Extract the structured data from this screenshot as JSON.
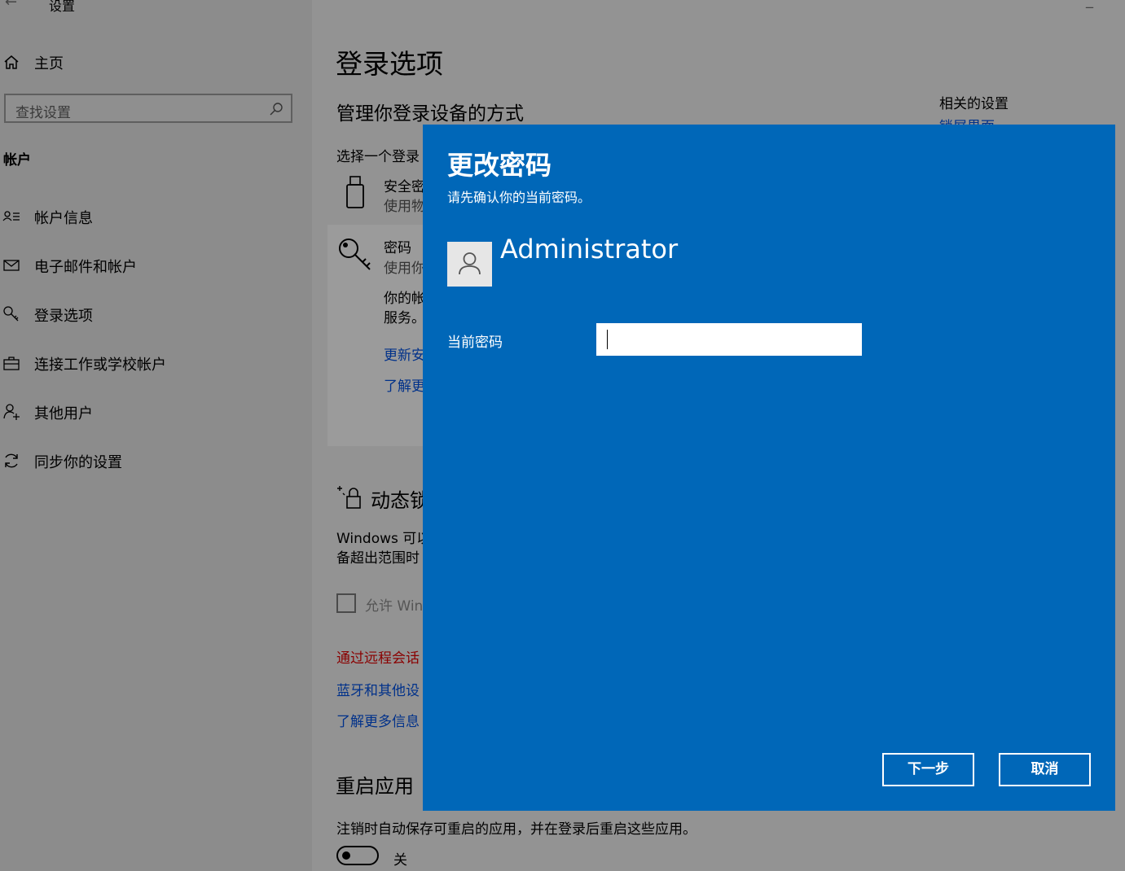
{
  "window": {
    "title": "设置"
  },
  "sidebar": {
    "home": "主页",
    "search_placeholder": "查找设置",
    "section": "帐户",
    "items": [
      {
        "label": "帐户信息",
        "icon": "account-info-icon"
      },
      {
        "label": "电子邮件和帐户",
        "icon": "mail-icon"
      },
      {
        "label": "登录选项",
        "icon": "key-icon"
      },
      {
        "label": "连接工作或学校帐户",
        "icon": "briefcase-icon"
      },
      {
        "label": "其他用户",
        "icon": "add-user-icon"
      },
      {
        "label": "同步你的设置",
        "icon": "sync-icon"
      }
    ]
  },
  "main": {
    "title": "登录选项",
    "subtitle": "管理你登录设备的方式",
    "choose_prefix": "选择一个登录",
    "security_key": {
      "title": "安全密",
      "desc": "使用物"
    },
    "password": {
      "title": "密码",
      "desc": "使用你",
      "body_line1": "你的帐",
      "body_line2": "服务。",
      "link1": "更新安",
      "link2": "了解更"
    },
    "dynamic_lock": {
      "title": "动态锁",
      "desc_line1": "Windows 可以",
      "desc_line2": "备超出范围时",
      "checkbox_label": "允许 Win",
      "link_remote": "通过远程会话",
      "link_bluetooth": "蓝牙和其他设",
      "link_learn": "了解更多信息"
    },
    "restart_apps": {
      "title": "重启应用",
      "desc": "注销时自动保存可重启的应用，并在登录后重启这些应用。",
      "toggle_state": "关"
    },
    "related": {
      "title": "相关的设置",
      "partial": "锁屏界面"
    }
  },
  "dialog": {
    "title": "更改密码",
    "subtitle": "请先确认你的当前密码。",
    "username": "Administrator",
    "field_label": "当前密码",
    "field_value": "",
    "next_button": "下一步",
    "cancel_button": "取消"
  },
  "colors": {
    "dialog_bg": "#0067b8",
    "link_blue": "#00318a",
    "link_red": "#8a0000"
  }
}
